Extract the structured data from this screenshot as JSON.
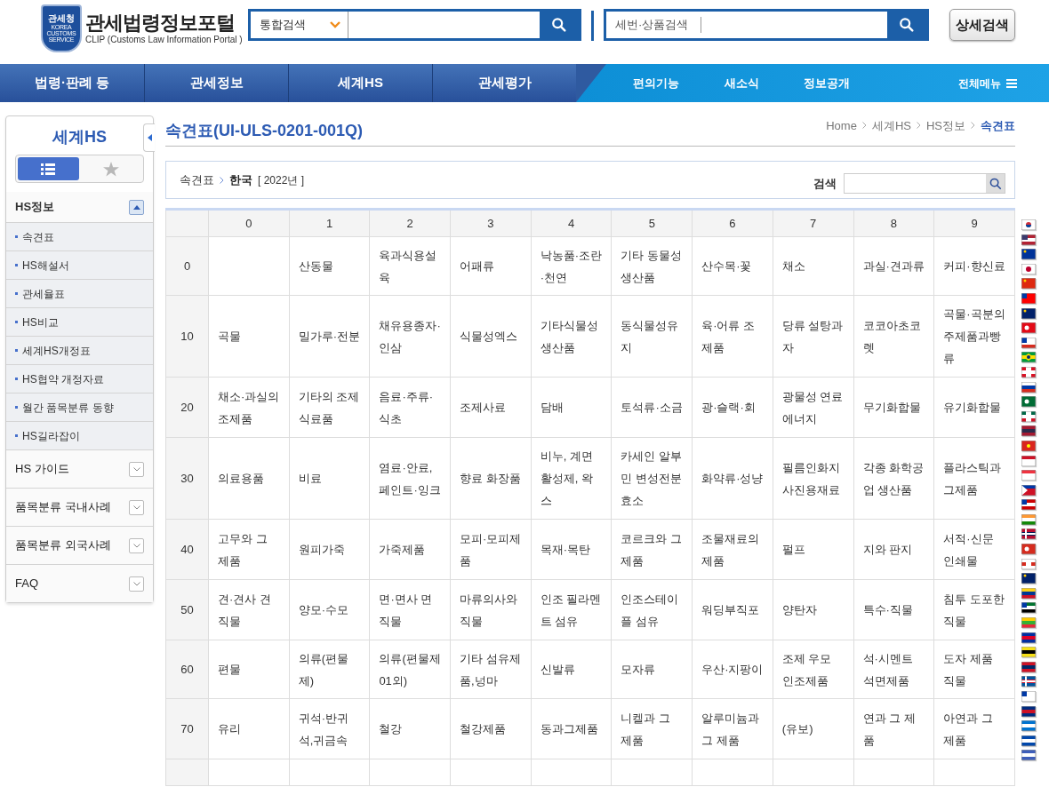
{
  "header": {
    "logo": {
      "emblem_lines": [
        "관세청",
        "KOREA",
        "CUSTOMS",
        "SERVICE"
      ],
      "title": "관세법령정보포털",
      "subtitle": "CLIP (Customs Law Information Portal )"
    },
    "search": {
      "scope": "통합검색"
    },
    "hs_search": {
      "label": "세번·상품검색"
    },
    "detail_button": "상세검색"
  },
  "nav": {
    "main": [
      "법령·판례 등",
      "관세정보",
      "세계HS",
      "관세평가"
    ],
    "sub": [
      "편의기능",
      "새소식",
      "정보공개"
    ],
    "all_menu": "전체메뉴"
  },
  "sidebar": {
    "title": "세계HS",
    "view_tabs": [
      {
        "kind": "list",
        "selected": true
      },
      {
        "kind": "star",
        "selected": false
      }
    ],
    "sections": [
      {
        "label": "HS정보",
        "expanded": true,
        "items": [
          "속견표",
          "HS해설서",
          "관세율표",
          "HS비교",
          "세계HS개정표",
          "HS협약 개정자료",
          "월간 품목분류 동향",
          "HS길라잡이"
        ]
      },
      {
        "label": "HS 가이드",
        "expanded": false
      },
      {
        "label": "품목분류 국내사례",
        "expanded": false
      },
      {
        "label": "품목분류 외국사례",
        "expanded": false
      },
      {
        "label": "FAQ",
        "expanded": false
      }
    ]
  },
  "page": {
    "title": "속견표(UI-ULS-0201-001Q)",
    "breadcrumb": [
      "Home",
      "세계HS",
      "HS정보",
      "속견표"
    ],
    "path": {
      "root": "속견표",
      "country": "한국",
      "year": "[ 2022년 ]"
    },
    "search_label": "검색"
  },
  "table": {
    "columns": [
      "0",
      "1",
      "2",
      "3",
      "4",
      "5",
      "6",
      "7",
      "8",
      "9"
    ],
    "rows": [
      {
        "head": "0",
        "cells": [
          "",
          "산동물",
          "육과식용설육",
          "어패류",
          "낙농품·조란·천연",
          "기타 동물성 생산품",
          "산수목·꽃",
          "채소",
          "과실·견과류",
          "커피·향신료"
        ]
      },
      {
        "head": "10",
        "cells": [
          "곡물",
          "밀가루·전분",
          "채유용종자·인삼",
          "식물성엑스",
          "기타식물성 생산품",
          "동식물성유지",
          "육·어류 조제품",
          "당류 설탕과자",
          "코코아초코렛",
          "곡물·곡분의 주제품과빵류"
        ]
      },
      {
        "head": "20",
        "cells": [
          "채소·과실의 조제품",
          "기타의 조제 식료품",
          "음료·주류·식초",
          "조제사료",
          "담배",
          "토석류·소금",
          "광·슬랙·회",
          "광물성 연료 에너지",
          "무기화합물",
          "유기화합물"
        ]
      },
      {
        "head": "30",
        "cells": [
          "의료용품",
          "비료",
          "염료·안료, 페인트·잉크",
          "향료 화장품",
          "비누, 계면 활성제, 왁스",
          "카세인 알부민 변성전분 효소",
          "화약류·성냥",
          "필름인화지 사진용재료",
          "각종 화학공업 생산품",
          "플라스틱과 그제품"
        ]
      },
      {
        "head": "40",
        "cells": [
          "고무와 그 제품",
          "원피가죽",
          "가죽제품",
          "모피·모피제품",
          "목재·목탄",
          "코르크와 그 제품",
          "조물재료의 제품",
          "펄프",
          "지와 판지",
          "서적·신문 인쇄물"
        ]
      },
      {
        "head": "50",
        "cells": [
          "견·견사 견직물",
          "양모·수모",
          "면·면사 면직물",
          "마류의사와 직물",
          "인조 필라멘트 섬유",
          "인조스테이플 섬유",
          "워딩부직포",
          "양탄자",
          "특수·직물",
          "침투 도포한 직물"
        ]
      },
      {
        "head": "60",
        "cells": [
          "편물",
          "의류(편물제)",
          "의류(편물제01외)",
          "기타 섬유제품,넝마",
          "신발류",
          "모자류",
          "우산·지팡이",
          "조제 우모 인조제품",
          "석·시멘트 석면제품",
          "도자 제품 직물"
        ]
      },
      {
        "head": "70",
        "cells": [
          "유리",
          "귀석·반귀석,귀금속",
          "철강",
          "철강제품",
          "동과그제품",
          "니켈과 그 제품",
          "알루미늄과 그 제품",
          "(유보)",
          "연과 그 제품",
          "아연과 그 제품"
        ]
      }
    ]
  }
}
